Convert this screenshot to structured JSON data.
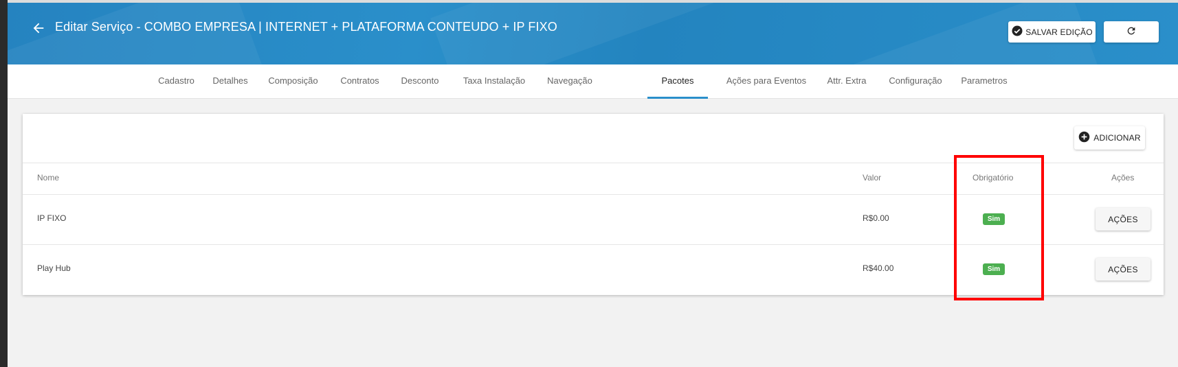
{
  "header": {
    "title": "Editar Serviço - COMBO EMPRESA | INTERNET + PLATAFORMA CONTEUDO + IP FIXO",
    "back_icon": "arrow-left-icon",
    "save_label": "SALVAR EDIÇÃO",
    "save_icon": "check-circle-icon",
    "refresh_icon": "refresh-icon"
  },
  "tabs": [
    {
      "label": "Cadastro"
    },
    {
      "label": "Detalhes"
    },
    {
      "label": "Composição"
    },
    {
      "label": "Contratos"
    },
    {
      "label": "Desconto"
    },
    {
      "label": "Taxa Instalação"
    },
    {
      "label": "Navegação"
    },
    {
      "label": "Pacotes",
      "active": true
    },
    {
      "label": "Ações para Eventos"
    },
    {
      "label": "Attr. Extra"
    },
    {
      "label": "Configuração"
    },
    {
      "label": "Parametros"
    }
  ],
  "card": {
    "add_label": "ADICIONAR",
    "add_icon": "plus-circle-icon",
    "columns": {
      "nome": "Nome",
      "valor": "Valor",
      "obrigatorio": "Obrigatório",
      "acoes": "Ações"
    },
    "rows": [
      {
        "nome": "IP FIXO",
        "valor": "R$0.00",
        "obrigatorio": "Sim",
        "acoes": "AÇÕES"
      },
      {
        "nome": "Play Hub",
        "valor": "R$40.00",
        "obrigatorio": "Sim",
        "acoes": "AÇÕES"
      }
    ]
  },
  "colors": {
    "header_blue": "#2a8fca",
    "badge_green": "#4caf50",
    "highlight_red": "#ff0000"
  }
}
